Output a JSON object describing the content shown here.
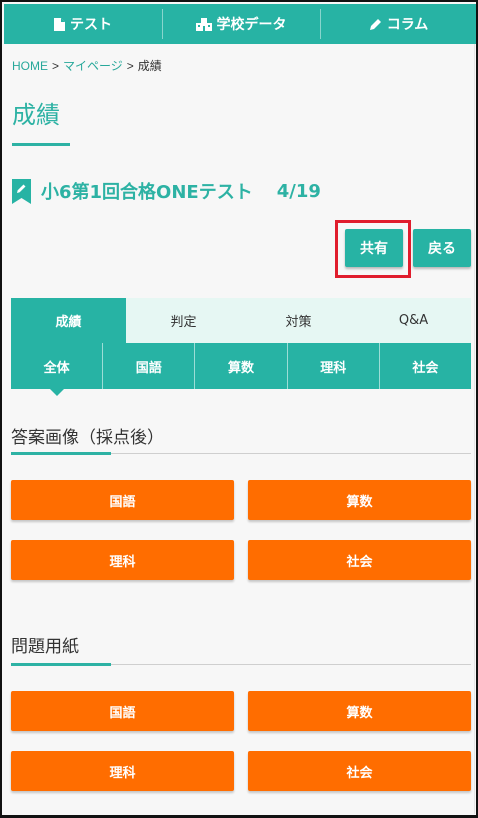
{
  "nav": {
    "test": {
      "label": "テスト",
      "icon": "document-icon"
    },
    "school": {
      "label": "学校データ",
      "icon": "school-icon"
    },
    "column": {
      "label": "コラム",
      "icon": "pencil-icon"
    }
  },
  "breadcrumb": {
    "home": "HOME",
    "mypage": "マイページ",
    "current": "成績",
    "separator": ">"
  },
  "page": {
    "title": "成績"
  },
  "test": {
    "name": "小6第1回合格ONEテスト",
    "date": "4/19"
  },
  "actions": {
    "share": "共有",
    "back": "戻る"
  },
  "main_tabs": [
    {
      "label": "成績",
      "active": true
    },
    {
      "label": "判定",
      "active": false
    },
    {
      "label": "対策",
      "active": false
    },
    {
      "label": "Q&A",
      "active": false
    }
  ],
  "subject_tabs": [
    {
      "label": "全体",
      "active": true
    },
    {
      "label": "国語",
      "active": false
    },
    {
      "label": "算数",
      "active": false
    },
    {
      "label": "理科",
      "active": false
    },
    {
      "label": "社会",
      "active": false
    }
  ],
  "answer_section": {
    "title": "答案画像（採点後）",
    "buttons": [
      "国語",
      "算数",
      "理科",
      "社会"
    ]
  },
  "question_section": {
    "title": "問題用紙",
    "buttons": [
      "国語",
      "算数",
      "理科",
      "社会"
    ]
  },
  "colors": {
    "teal": "#27b3a4",
    "orange": "#ff6d00",
    "highlight_red": "#e01d2d",
    "tab_bg": "#e6f7f3"
  }
}
